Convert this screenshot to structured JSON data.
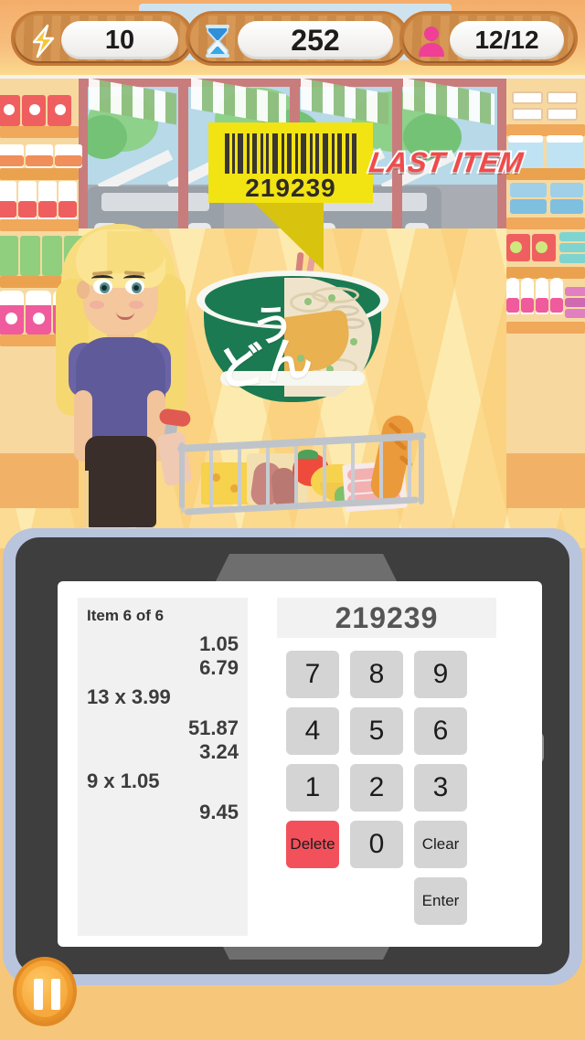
{
  "hud": {
    "energy": {
      "icon": "lightning-bolt-icon",
      "value": "10",
      "color": "#f2c12e"
    },
    "timer": {
      "icon": "hourglass-icon",
      "value": "252",
      "color": "#3aa0e8"
    },
    "customers": {
      "icon": "person-icon",
      "value": "12/12",
      "color": "#ef3f96"
    }
  },
  "scene": {
    "barcode": {
      "number": "219239",
      "label_color": "#f2e313"
    },
    "last_item_banner": "LAST ITEM",
    "product": {
      "name": "udon-noodle-bowl",
      "jp_line1": "う",
      "jp_line2": "どん",
      "bowl_color": "#1b7a52"
    },
    "character": "shopper-woman",
    "cart": "shopping-cart"
  },
  "tablet": {
    "receipt": {
      "title": "Item 6 of 6",
      "rows": [
        {
          "left": "",
          "right": "1.05"
        },
        {
          "left": "",
          "right": "6.79"
        },
        {
          "left": "13 x 3.99",
          "right": ""
        },
        {
          "left": "",
          "right": "51.87"
        },
        {
          "left": "",
          "right": "3.24"
        },
        {
          "left": "9 x  1.05",
          "right": ""
        },
        {
          "left": "",
          "right": "9.45"
        }
      ]
    },
    "keypad": {
      "display": "219239",
      "keys": {
        "k7": "7",
        "k8": "8",
        "k9": "9",
        "k4": "4",
        "k5": "5",
        "k6": "6",
        "k1": "1",
        "k2": "2",
        "k3": "3",
        "delete": "Delete",
        "k0": "0",
        "clear": "Clear",
        "enter": "Enter"
      },
      "delete_color": "#f2515c"
    }
  },
  "controls": {
    "pause": "pause-button"
  }
}
